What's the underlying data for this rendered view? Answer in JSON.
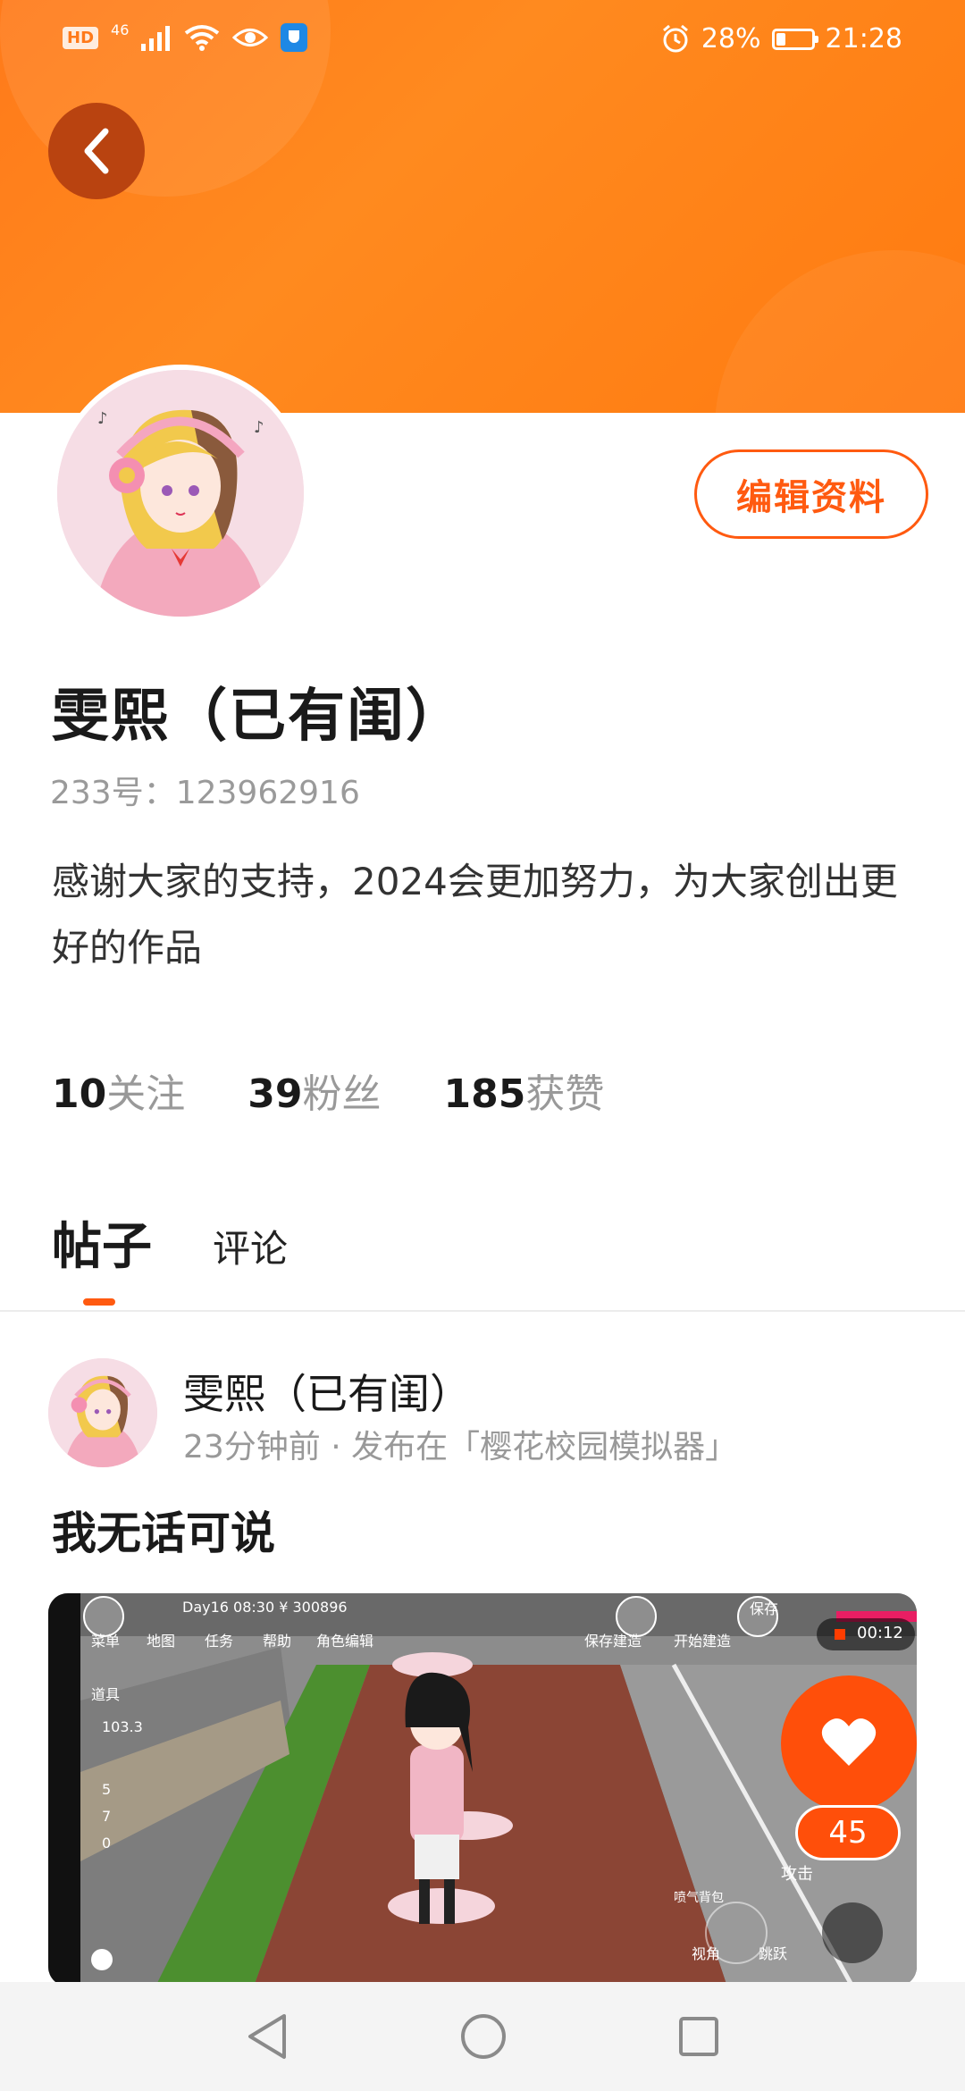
{
  "status_bar": {
    "hd": "HD",
    "signal": "46",
    "battery": "28%",
    "battery_fraction": 0.28,
    "time": "21:28"
  },
  "profile": {
    "nickname": "雯熙（已有闺）",
    "uid": "233号：123962916",
    "bio": "感谢大家的支持，2024会更加努力，为大家创出更好的作品",
    "edit_button": "编辑资料",
    "stats": [
      {
        "num": "10",
        "label": "关注"
      },
      {
        "num": "39",
        "label": "粉丝"
      },
      {
        "num": "185",
        "label": "获赞"
      }
    ]
  },
  "tabs": [
    {
      "label": "帖子",
      "active": true
    },
    {
      "label": "评论",
      "active": false
    }
  ],
  "post": {
    "author": "雯熙（已有闺）",
    "meta": "23分钟前 · 发布在「樱花校园模拟器」",
    "text": "我无话可说",
    "game_hud": {
      "menu": "菜单",
      "map": "地图",
      "task": "任务",
      "help": "帮助",
      "role_edit": "角色编辑",
      "items": "道具",
      "day": "Day16 08:30 ¥ 300896",
      "save_build": "保存建造",
      "start_build": "开始建造",
      "save": "保存",
      "rec_time": "00:12",
      "money": "103.3",
      "stat1": "5",
      "stat2": "7",
      "stat3": "0",
      "attack": "攻击",
      "special": "喷气背包",
      "view": "视角",
      "jump": "跳跃"
    },
    "likes": "45"
  },
  "colors": {
    "accent": "#ff5a10",
    "header": "#ff7a1a"
  }
}
